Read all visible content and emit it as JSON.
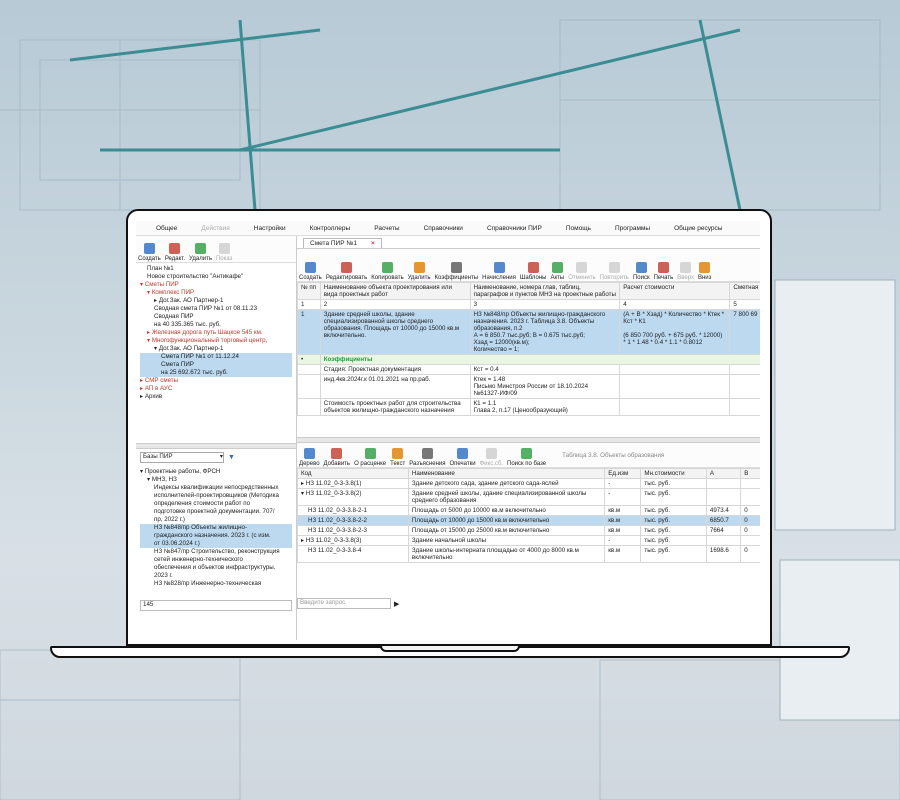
{
  "menu": [
    "Общее",
    "Действия",
    "Настройки",
    "Контроллеры",
    "Расчеты",
    "Справочники",
    "Справочники ПИР",
    "Помощь",
    "Программы",
    "Общие ресурсы"
  ],
  "left_toolbar": [
    {
      "label": "Создать",
      "icon": "monitor-icon"
    },
    {
      "label": "Редакт.",
      "icon": "pencil-icon"
    },
    {
      "label": "Удалить",
      "icon": "trash-icon"
    },
    {
      "label": "Показ",
      "icon": "eye-icon",
      "disabled": true
    }
  ],
  "left_tree": [
    {
      "t": "План №1",
      "lvl": 1
    },
    {
      "t": "Новое строительство \"Антикафе\"",
      "lvl": 1
    },
    {
      "t": "▾ Сметы ПИР",
      "lvl": 0,
      "c": "red"
    },
    {
      "t": "▾ Комплекс ПИР",
      "lvl": 1,
      "c": "red"
    },
    {
      "t": "▸ Дог.Зак. АО Партнер-1",
      "lvl": 2
    },
    {
      "t": "Сводная смета ПИР №1 от 08.11.23",
      "lvl": 2
    },
    {
      "t": "Сводная ПИР",
      "lvl": 2
    },
    {
      "t": "на 40 335.365 тыс. руб.",
      "lvl": 2
    },
    {
      "t": "▸ Железная дорога путь Шацкое 545 км.",
      "lvl": 1,
      "c": "red"
    },
    {
      "t": "▾ Многофункциональный торговый центр,",
      "lvl": 1,
      "c": "red"
    },
    {
      "t": "▾ Дог.Зак. АО Партнер-1",
      "lvl": 2
    },
    {
      "t": "Смета ПИР №1 от 11.12.24",
      "lvl": 3,
      "sel": true
    },
    {
      "t": "Смета ПИР",
      "lvl": 3,
      "sel": true
    },
    {
      "t": "на 25 692.672 тыс. руб.",
      "lvl": 3,
      "sel": true
    },
    {
      "t": "▸ СМР сметы",
      "lvl": 0,
      "c": "red"
    },
    {
      "t": "▸ АП в АУС",
      "lvl": 0,
      "c": "red"
    },
    {
      "t": "▸ Архив",
      "lvl": 0
    }
  ],
  "bases_select": "Базы ПИР",
  "bases_tree": [
    {
      "t": "▾ Проектные работы, ФРСН",
      "lvl": 0
    },
    {
      "t": "▾ МНЗ, НЗ",
      "lvl": 1
    },
    {
      "t": "Индексы квалификации непосредственных",
      "lvl": 2
    },
    {
      "t": "исполнителей-проектировщиков (Методика",
      "lvl": 2
    },
    {
      "t": "определения стоимости работ по",
      "lvl": 2
    },
    {
      "t": "подготовке проектной документации. 707/",
      "lvl": 2
    },
    {
      "t": "пр, 2022 г.)",
      "lvl": 2
    },
    {
      "t": "НЗ №848/пр Объекты жилищно-",
      "lvl": 2,
      "sel": true
    },
    {
      "t": "гражданского назначения. 2023 г. (с изм.",
      "lvl": 2,
      "sel": true
    },
    {
      "t": "от 03.06.2024 г.)",
      "lvl": 2,
      "sel": true
    },
    {
      "t": "НЗ №847/пр Строительство, реконструкция",
      "lvl": 2
    },
    {
      "t": "сетей инженерно-технического",
      "lvl": 2
    },
    {
      "t": "обеспечения и объектов инфраструктуры.",
      "lvl": 2
    },
    {
      "t": "2023 г.",
      "lvl": 2
    },
    {
      "t": "НЗ №828/пр Инженерно-техническая",
      "lvl": 2
    }
  ],
  "bases_search": "145",
  "doc_tab": "Смета ПИР №1",
  "main_toolbar": [
    {
      "label": "Создать",
      "icon": "create-icon"
    },
    {
      "label": "Редактировать",
      "icon": "edit-icon"
    },
    {
      "label": "Копировать",
      "icon": "copy-icon"
    },
    {
      "label": "Удалить",
      "icon": "delete-icon"
    },
    {
      "label": "Коэффициенты",
      "icon": "coefficients-icon"
    },
    {
      "label": "Начисления",
      "icon": "charges-icon"
    },
    {
      "label": "Шаблоны",
      "icon": "templates-icon"
    },
    {
      "label": "Акты",
      "icon": "acts-icon"
    },
    {
      "label": "Отменить",
      "icon": "undo-icon",
      "disabled": true
    },
    {
      "label": "Повторить",
      "icon": "redo-icon",
      "disabled": true
    },
    {
      "label": "Поиск",
      "icon": "search-icon"
    },
    {
      "label": "Печать",
      "icon": "print-icon"
    },
    {
      "label": "Вверх",
      "icon": "up-icon",
      "disabled": true
    },
    {
      "label": "Вниз",
      "icon": "down-icon"
    }
  ],
  "estimate_table": {
    "headers": [
      "№ пп",
      "Наименование объекта проектирования или вида проектных работ",
      "Наименование, номера глав, таблиц, параграфов и пунктов МНЗ на проектные работы",
      "Расчет стоимости",
      "Сметная"
    ],
    "nums": [
      "1",
      "2",
      "3",
      "4",
      "5"
    ],
    "row1": {
      "n": "1",
      "name": "Здание средней школы, здание специализированной школы среднего образования. Площадь от 10000 до 15000 кв.м включительно.",
      "ref": "НЗ №848/пр Объекты жилищно-гражданского назначения. 2023 г. Таблица 3.8. Объекты образования, п.2\nА = 6 850.7 тыс.руб; В = 0.675 тыс.руб;\nХзад = 12000(кв.м);\nКоличество = 1;",
      "calc": "(А + В * Хзад) * Количество * Ктек * Кст * К1\n\n(6 850 700 руб. + 675 руб. * 12000) * 1 * 1.48 * 0.4 * 1.1 * 0.8012",
      "sum": "7 800 69"
    },
    "coef_label": "Коэффициенты",
    "coef_rows": [
      {
        "a": "Стадия: Проектная документация",
        "b": "Кст = 0.4"
      },
      {
        "a": "инд.4кв.2024г.к 01.01.2021 на пр.раб.",
        "b": "Ктек = 1.48\nПисьмо Минстроя России от 18.10.2024\n№61327-ИФ/09"
      },
      {
        "a": "Стоимость проектных работ для строительства объектов жилищно-гражданского назначения",
        "b": "К1 = 1.1\nГлава 2, п.17 (Ценообразующий)"
      }
    ]
  },
  "lower_toolbar": [
    {
      "label": "Дерево",
      "icon": "tree-icon"
    },
    {
      "label": "Добавить",
      "icon": "add-icon"
    },
    {
      "label": "О расценке",
      "icon": "info-icon"
    },
    {
      "label": "Текст",
      "icon": "text-icon"
    },
    {
      "label": "Разъяснения",
      "icon": "explain-icon"
    },
    {
      "label": "Опечатки",
      "icon": "typo-icon"
    },
    {
      "label": "Фикс.сб.",
      "icon": "fix-icon",
      "disabled": true
    },
    {
      "label": "Поиск по базе",
      "icon": "search-base-icon"
    }
  ],
  "lower_caption": "Таблица 3.8. Объекты образования",
  "norm_table": {
    "headers": [
      "Код",
      "Наименование",
      "Ед.изм",
      "Мн.стоимости",
      "А",
      "В"
    ],
    "rows": [
      {
        "code": "▸ НЗ 11.02_0-3-3.8(1)",
        "name": "Здание детского сада, здание детского сада-яслей",
        "u": "-",
        "m": "тыс. руб.",
        "a": "",
        "b": ""
      },
      {
        "code": "▾ НЗ 11.02_0-3-3.8(2)",
        "name": "Здание средней школы, здание специализированной школы среднего образования",
        "u": "-",
        "m": "тыс. руб.",
        "a": "",
        "b": ""
      },
      {
        "code": "НЗ 11.02_0-3-3.8-2-1",
        "name": "Площадь от 5000 до 10000 кв.м включительно",
        "u": "кв.м",
        "m": "тыс. руб.",
        "a": "4973.4",
        "b": "0"
      },
      {
        "code": "НЗ 11.02_0-3-3.8-2-2",
        "name": "Площадь от 10000 до 15000 кв.м включительно",
        "u": "кв.м",
        "m": "тыс. руб.",
        "a": "6850.7",
        "b": "0",
        "sel": true
      },
      {
        "code": "НЗ 11.02_0-3-3.8-2-3",
        "name": "Площадь от 15000 до 25000 кв.м включительно",
        "u": "кв.м",
        "m": "тыс. руб.",
        "a": "7664",
        "b": "0"
      },
      {
        "code": "▸ НЗ 11.02_0-3-3.8(3)",
        "name": "Здание начальной школы",
        "u": "-",
        "m": "тыс. руб.",
        "a": "",
        "b": ""
      },
      {
        "code": "НЗ 11.02_0-3-3.8-4",
        "name": "Здание школы-интерната площадью от 4000 до 8000 кв.м включительно",
        "u": "кв.м",
        "m": "тыс. руб.",
        "a": "1698.6",
        "b": "0"
      }
    ]
  },
  "query_placeholder": "Введите запрос"
}
